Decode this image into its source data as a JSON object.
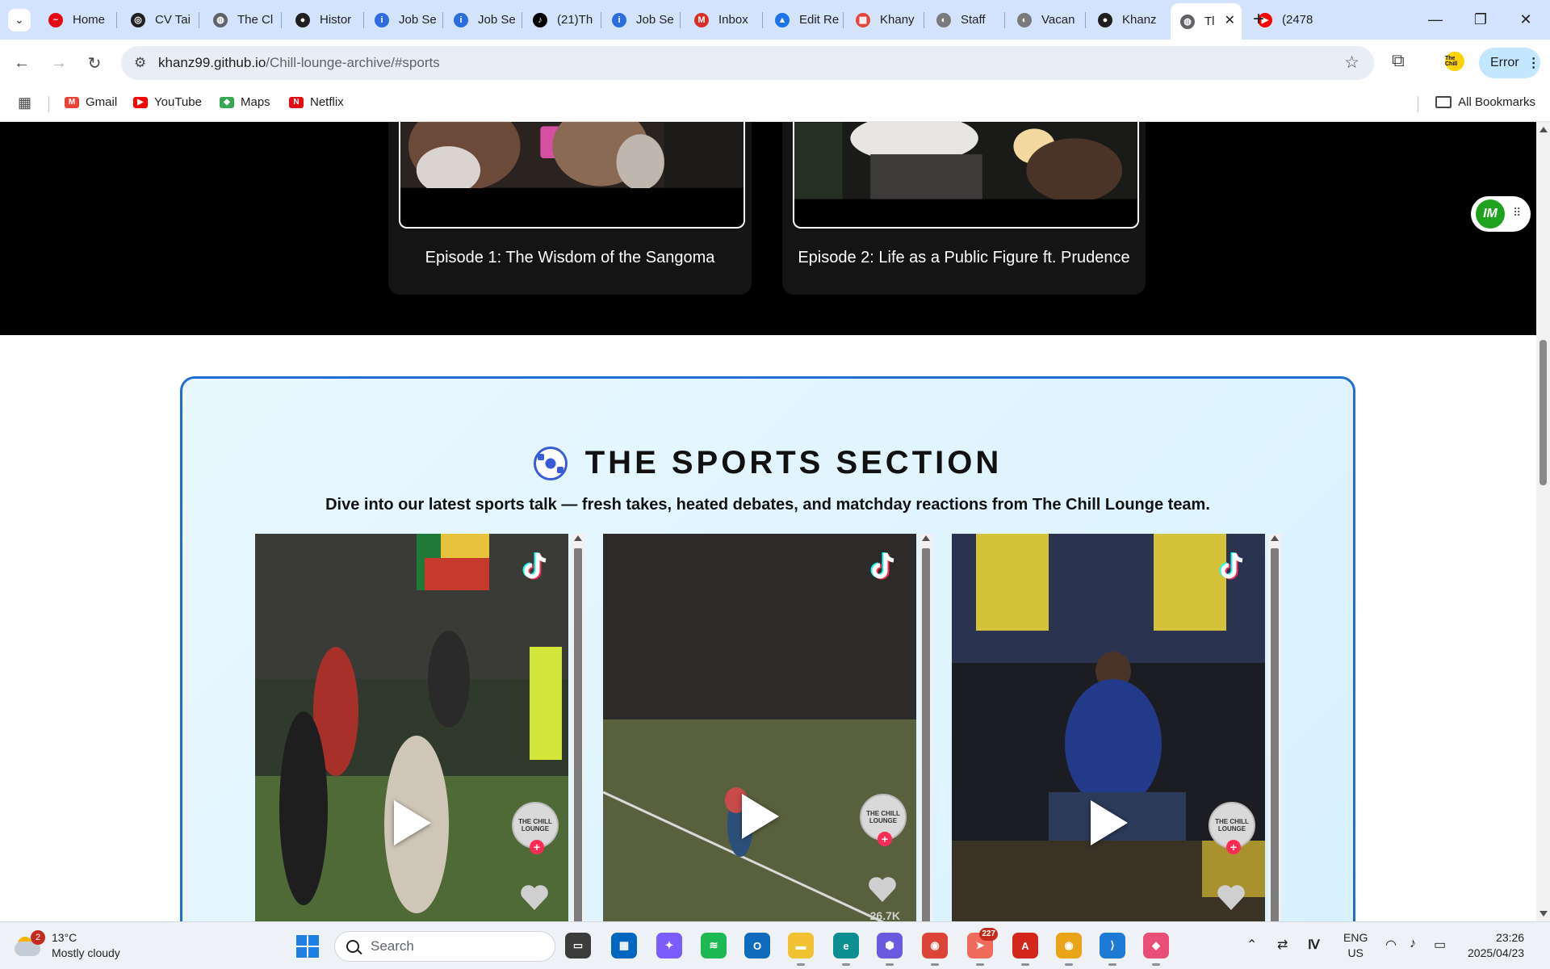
{
  "browser": {
    "tabs": [
      {
        "title": "Home",
        "color": "#e50914",
        "glyph": "~"
      },
      {
        "title": "CV Tai",
        "color": "#1f1f1f",
        "glyph": "◎"
      },
      {
        "title": "The Cl",
        "color": "#5f6368",
        "glyph": "◍"
      },
      {
        "title": "Histor",
        "color": "#1f1f1f",
        "glyph": "●"
      },
      {
        "title": "Job Se",
        "color": "#2d6cdf",
        "glyph": "i"
      },
      {
        "title": "Job Se",
        "color": "#2d6cdf",
        "glyph": "i"
      },
      {
        "title": "(21)Th",
        "color": "#000000",
        "glyph": "♪"
      },
      {
        "title": "Job Se",
        "color": "#2d6cdf",
        "glyph": "i"
      },
      {
        "title": "Inbox",
        "color": "#d93025",
        "glyph": "M"
      },
      {
        "title": "Edit Re",
        "color": "#1a73e8",
        "glyph": "▲"
      },
      {
        "title": "Khany",
        "color": "#e8453c",
        "glyph": "▦"
      },
      {
        "title": "Staff",
        "color": "#7a7a7a",
        "glyph": "◐"
      },
      {
        "title": "Vacan",
        "color": "#7a7a7a",
        "glyph": "◐"
      },
      {
        "title": "Khanz",
        "color": "#1f1f1f",
        "glyph": "●"
      },
      {
        "title": "Tl",
        "color": "#5f6368",
        "glyph": "◍",
        "active": true
      },
      {
        "title": "(2478",
        "color": "#ff0000",
        "glyph": "▶"
      }
    ],
    "url_host": "khanz99.github.io",
    "url_path": "/Chill-lounge-archive/#sports",
    "error_label": "Error",
    "profile_label": "The Chill",
    "bookmarks": [
      {
        "label": "Gmail",
        "color": "#ea4335",
        "glyph": "M"
      },
      {
        "label": "YouTube",
        "color": "#ff0000",
        "glyph": "▶"
      },
      {
        "label": "Maps",
        "color": "#34a853",
        "glyph": "◆"
      },
      {
        "label": "Netflix",
        "color": "#e50914",
        "glyph": "N"
      }
    ],
    "all_bookmarks": "All Bookmarks"
  },
  "page": {
    "episodes": [
      {
        "title": "Episode 1: The Wisdom of the Sangoma"
      },
      {
        "title": "Episode 2: Life as a Public Figure ft. Prudence"
      }
    ],
    "sports": {
      "title": "THE SPORTS SECTION",
      "subtitle": "Dive into our latest sports talk — fresh takes, heated debates, and matchday reactions from The Chill Lounge team.",
      "videos": [
        {
          "avatar_text": "THE CHILL LOUNGE",
          "likes": ""
        },
        {
          "avatar_text": "THE CHILL LOUNGE",
          "likes": "26.7K"
        },
        {
          "avatar_text": "THE CHILL LOUNGE",
          "likes": ""
        }
      ]
    },
    "fab_logo": "IM"
  },
  "taskbar": {
    "weather_temp": "13°C",
    "weather_desc": "Mostly cloudy",
    "weather_alerts": "2",
    "search_placeholder": "Search",
    "apps": [
      {
        "name": "task-view",
        "color": "#3b3b3b",
        "glyph": "▭"
      },
      {
        "name": "microsoft-store",
        "color": "#0067c0",
        "glyph": "▦"
      },
      {
        "name": "copilot",
        "color": "#7a5cff",
        "glyph": "✦"
      },
      {
        "name": "spotify",
        "color": "#1db954",
        "glyph": "≋"
      },
      {
        "name": "outlook",
        "color": "#0f6cbd",
        "glyph": "O"
      },
      {
        "name": "file-explorer",
        "color": "#f2c230",
        "glyph": "▬"
      },
      {
        "name": "edge",
        "color": "#0c8f8f",
        "glyph": "e"
      },
      {
        "name": "copilot-app",
        "color": "#6a5ae0",
        "glyph": "⬢"
      },
      {
        "name": "chrome-profile",
        "color": "#db4437",
        "glyph": "◉"
      },
      {
        "name": "telegram",
        "color": "#f06b5b",
        "glyph": "➤",
        "badge": "227"
      },
      {
        "name": "acrobat",
        "color": "#d3271c",
        "glyph": "A"
      },
      {
        "name": "chrome",
        "color": "#e8a317",
        "glyph": "◉"
      },
      {
        "name": "vscode",
        "color": "#1f7ad6",
        "glyph": "⟩"
      },
      {
        "name": "gemini-app",
        "color": "#e94f76",
        "glyph": "◆"
      }
    ],
    "lang_top": "ENG",
    "lang_bottom": "US",
    "time": "23:26",
    "date": "2025/04/23"
  }
}
